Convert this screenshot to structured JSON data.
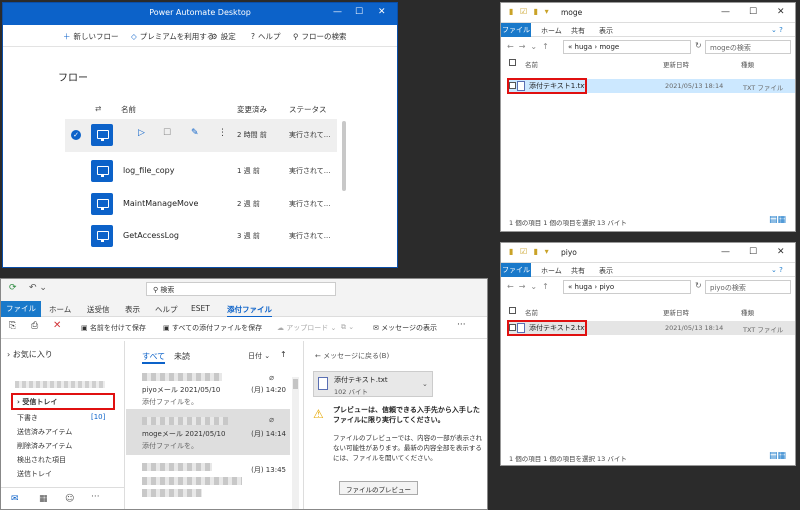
{
  "pad": {
    "title": "Power Automate Desktop",
    "toolbar": {
      "new_flow": "新しいフロー",
      "premium": "プレミアムを利用する",
      "settings": "設定",
      "help": "ヘルプ",
      "search": "フローの検索"
    },
    "heading": "フロー",
    "columns": {
      "name": "名前",
      "modified": "変更済み",
      "status": "ステータス"
    },
    "flows": [
      {
        "name": "",
        "modified": "2 時間 前",
        "status": "実行されて..."
      },
      {
        "name": "log_file_copy",
        "modified": "1 週 前",
        "status": "実行されて..."
      },
      {
        "name": "MaintManageMove",
        "modified": "2 週 前",
        "status": "実行されて..."
      },
      {
        "name": "GetAccessLog",
        "modified": "3 週 前",
        "status": "実行されて..."
      }
    ]
  },
  "explorer_moge": {
    "title": "moge",
    "ribbon": {
      "file": "ファイル",
      "home": "ホーム",
      "share": "共有",
      "view": "表示"
    },
    "path": "«  huga  ›  moge",
    "search_placeholder": "mogeの検索",
    "columns": {
      "name": "名前",
      "date": "更新日時",
      "type": "種類"
    },
    "file": {
      "name": "添付テキスト1.txt",
      "date": "2021/05/13 18:14",
      "type": "TXT ファイル"
    },
    "status": "1 個の項目    1 個の項目を選択  13 バイト"
  },
  "explorer_piyo": {
    "title": "piyo",
    "ribbon": {
      "file": "ファイル",
      "home": "ホーム",
      "share": "共有",
      "view": "表示"
    },
    "path": "«  huga  ›  piyo",
    "search_placeholder": "piyoの検索",
    "columns": {
      "name": "名前",
      "date": "更新日時",
      "type": "種類"
    },
    "file": {
      "name": "添付テキスト2.txt",
      "date": "2021/05/13 18:14",
      "type": "TXT ファイル"
    },
    "status": "1 個の項目    1 個の項目を選択  13 バイト"
  },
  "outlook": {
    "search": "検索",
    "tabs": {
      "file": "ファイル",
      "home": "ホーム",
      "send_receive": "送受信",
      "view": "表示",
      "help": "ヘルプ",
      "eset": "ESET",
      "attachment": "添付ファイル"
    },
    "commands": {
      "save_as": "名前を付けて保存",
      "save_all": "すべての添付ファイルを保存",
      "upload": "アップロード",
      "show_message": "メッセージの表示"
    },
    "favorites": "お気に入り",
    "folders": {
      "inbox": "受信トレイ",
      "drafts": "下書き",
      "drafts_count": "[10]",
      "sent": "送信済みアイテム",
      "deleted": "削除済みアイテム",
      "detected": "検出された項目",
      "outbox": "送信トレイ"
    },
    "filters": {
      "all": "すべて",
      "unread": "未読",
      "sort": "日付 ⌄"
    },
    "messages": [
      {
        "subject": "piyoメール  2021/05/10",
        "date": "(月) 14:20",
        "preview": "添付ファイルを。"
      },
      {
        "subject": "mogeメール  2021/05/10",
        "date": "(月) 14:14",
        "preview": "添付ファイルを。"
      },
      {
        "subject": "",
        "date": "(月) 13:45",
        "preview": ""
      }
    ],
    "reading": {
      "back": "メッセージに戻る(B)",
      "attachment_name": "添付テキスト.txt",
      "attachment_size": "102 バイト",
      "warning_title": "プレビューは、信頼できる入手先から入手したファイルに限り実行してください。",
      "warning_body": "ファイルのプレビューでは、内容の一部が表示されない可能性があります。最新の内容全部を表示するには、ファイルを開いてください。",
      "preview_button": "ファイルのプレビュー"
    }
  }
}
